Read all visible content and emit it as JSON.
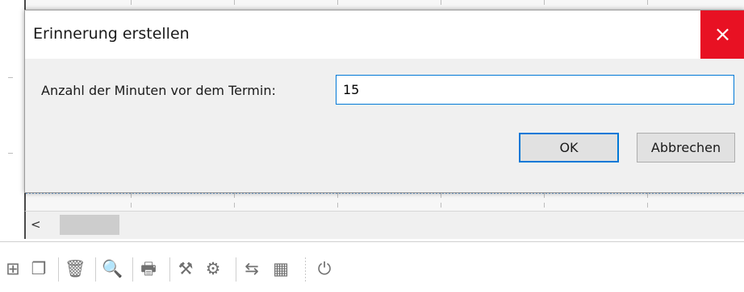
{
  "dialog": {
    "title": "Erinnerung erstellen",
    "close_icon": "×",
    "minutes_label": "Anzahl der Minuten vor dem Termin:",
    "minutes_value": "15",
    "ok_label": "OK",
    "cancel_label": "Abbrechen"
  },
  "scrollbar": {
    "left_arrow": "<"
  },
  "toolbar": {
    "icons": [
      {
        "name": "new-icon",
        "glyph": "⊞"
      },
      {
        "name": "copy-icon",
        "glyph": "❐"
      },
      {
        "name": "delete-icon",
        "glyph": "🗑"
      },
      {
        "name": "search-icon",
        "glyph": "🔍"
      },
      {
        "name": "print-icon",
        "glyph": "🖶"
      },
      {
        "name": "tools-icon",
        "glyph": "⚒"
      },
      {
        "name": "settings-icon",
        "glyph": "⚙"
      },
      {
        "name": "sync-icon",
        "glyph": "⇆"
      },
      {
        "name": "calendar-icon",
        "glyph": "▦"
      },
      {
        "name": "power-icon",
        "glyph": "⏻"
      }
    ]
  },
  "colors": {
    "accent": "#0078d7",
    "close": "#e81123"
  }
}
